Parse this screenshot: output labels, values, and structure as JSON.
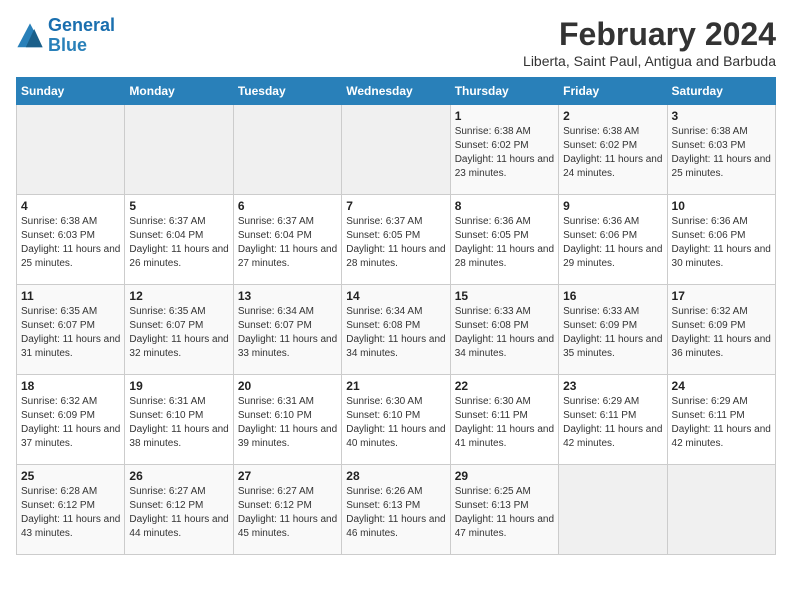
{
  "logo": {
    "line1": "General",
    "line2": "Blue"
  },
  "title": "February 2024",
  "subtitle": "Liberta, Saint Paul, Antigua and Barbuda",
  "weekdays": [
    "Sunday",
    "Monday",
    "Tuesday",
    "Wednesday",
    "Thursday",
    "Friday",
    "Saturday"
  ],
  "weeks": [
    [
      {
        "day": "",
        "info": ""
      },
      {
        "day": "",
        "info": ""
      },
      {
        "day": "",
        "info": ""
      },
      {
        "day": "",
        "info": ""
      },
      {
        "day": "1",
        "info": "Sunrise: 6:38 AM\nSunset: 6:02 PM\nDaylight: 11 hours and 23 minutes."
      },
      {
        "day": "2",
        "info": "Sunrise: 6:38 AM\nSunset: 6:02 PM\nDaylight: 11 hours and 24 minutes."
      },
      {
        "day": "3",
        "info": "Sunrise: 6:38 AM\nSunset: 6:03 PM\nDaylight: 11 hours and 25 minutes."
      }
    ],
    [
      {
        "day": "4",
        "info": "Sunrise: 6:38 AM\nSunset: 6:03 PM\nDaylight: 11 hours and 25 minutes."
      },
      {
        "day": "5",
        "info": "Sunrise: 6:37 AM\nSunset: 6:04 PM\nDaylight: 11 hours and 26 minutes."
      },
      {
        "day": "6",
        "info": "Sunrise: 6:37 AM\nSunset: 6:04 PM\nDaylight: 11 hours and 27 minutes."
      },
      {
        "day": "7",
        "info": "Sunrise: 6:37 AM\nSunset: 6:05 PM\nDaylight: 11 hours and 28 minutes."
      },
      {
        "day": "8",
        "info": "Sunrise: 6:36 AM\nSunset: 6:05 PM\nDaylight: 11 hours and 28 minutes."
      },
      {
        "day": "9",
        "info": "Sunrise: 6:36 AM\nSunset: 6:06 PM\nDaylight: 11 hours and 29 minutes."
      },
      {
        "day": "10",
        "info": "Sunrise: 6:36 AM\nSunset: 6:06 PM\nDaylight: 11 hours and 30 minutes."
      }
    ],
    [
      {
        "day": "11",
        "info": "Sunrise: 6:35 AM\nSunset: 6:07 PM\nDaylight: 11 hours and 31 minutes."
      },
      {
        "day": "12",
        "info": "Sunrise: 6:35 AM\nSunset: 6:07 PM\nDaylight: 11 hours and 32 minutes."
      },
      {
        "day": "13",
        "info": "Sunrise: 6:34 AM\nSunset: 6:07 PM\nDaylight: 11 hours and 33 minutes."
      },
      {
        "day": "14",
        "info": "Sunrise: 6:34 AM\nSunset: 6:08 PM\nDaylight: 11 hours and 34 minutes."
      },
      {
        "day": "15",
        "info": "Sunrise: 6:33 AM\nSunset: 6:08 PM\nDaylight: 11 hours and 34 minutes."
      },
      {
        "day": "16",
        "info": "Sunrise: 6:33 AM\nSunset: 6:09 PM\nDaylight: 11 hours and 35 minutes."
      },
      {
        "day": "17",
        "info": "Sunrise: 6:32 AM\nSunset: 6:09 PM\nDaylight: 11 hours and 36 minutes."
      }
    ],
    [
      {
        "day": "18",
        "info": "Sunrise: 6:32 AM\nSunset: 6:09 PM\nDaylight: 11 hours and 37 minutes."
      },
      {
        "day": "19",
        "info": "Sunrise: 6:31 AM\nSunset: 6:10 PM\nDaylight: 11 hours and 38 minutes."
      },
      {
        "day": "20",
        "info": "Sunrise: 6:31 AM\nSunset: 6:10 PM\nDaylight: 11 hours and 39 minutes."
      },
      {
        "day": "21",
        "info": "Sunrise: 6:30 AM\nSunset: 6:10 PM\nDaylight: 11 hours and 40 minutes."
      },
      {
        "day": "22",
        "info": "Sunrise: 6:30 AM\nSunset: 6:11 PM\nDaylight: 11 hours and 41 minutes."
      },
      {
        "day": "23",
        "info": "Sunrise: 6:29 AM\nSunset: 6:11 PM\nDaylight: 11 hours and 42 minutes."
      },
      {
        "day": "24",
        "info": "Sunrise: 6:29 AM\nSunset: 6:11 PM\nDaylight: 11 hours and 42 minutes."
      }
    ],
    [
      {
        "day": "25",
        "info": "Sunrise: 6:28 AM\nSunset: 6:12 PM\nDaylight: 11 hours and 43 minutes."
      },
      {
        "day": "26",
        "info": "Sunrise: 6:27 AM\nSunset: 6:12 PM\nDaylight: 11 hours and 44 minutes."
      },
      {
        "day": "27",
        "info": "Sunrise: 6:27 AM\nSunset: 6:12 PM\nDaylight: 11 hours and 45 minutes."
      },
      {
        "day": "28",
        "info": "Sunrise: 6:26 AM\nSunset: 6:13 PM\nDaylight: 11 hours and 46 minutes."
      },
      {
        "day": "29",
        "info": "Sunrise: 6:25 AM\nSunset: 6:13 PM\nDaylight: 11 hours and 47 minutes."
      },
      {
        "day": "",
        "info": ""
      },
      {
        "day": "",
        "info": ""
      }
    ]
  ]
}
